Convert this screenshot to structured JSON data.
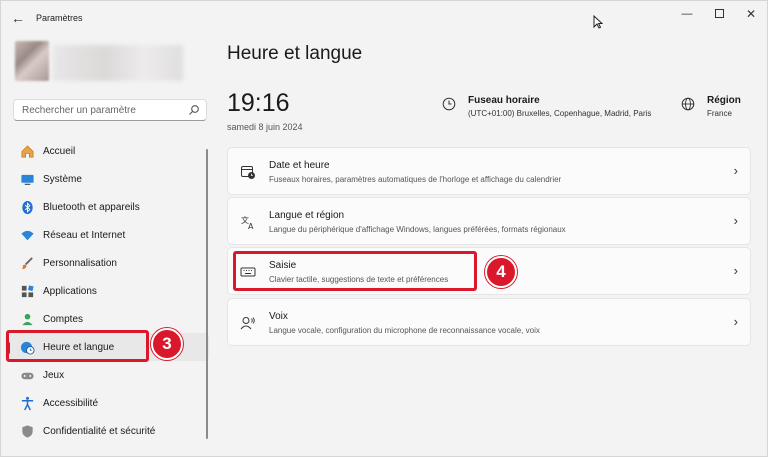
{
  "window": {
    "title": "Paramètres"
  },
  "search": {
    "placeholder": "Rechercher un paramètre"
  },
  "sidebar": {
    "items": [
      {
        "label": "Accueil",
        "icon": "home-icon"
      },
      {
        "label": "Système",
        "icon": "monitor-icon"
      },
      {
        "label": "Bluetooth et appareils",
        "icon": "bluetooth-icon"
      },
      {
        "label": "Réseau et Internet",
        "icon": "wifi-icon"
      },
      {
        "label": "Personnalisation",
        "icon": "brush-icon"
      },
      {
        "label": "Applications",
        "icon": "apps-icon"
      },
      {
        "label": "Comptes",
        "icon": "person-icon"
      },
      {
        "label": "Heure et langue",
        "icon": "globe-clock-icon",
        "active": true
      },
      {
        "label": "Jeux",
        "icon": "gamepad-icon"
      },
      {
        "label": "Accessibilité",
        "icon": "accessibility-icon"
      },
      {
        "label": "Confidentialité et sécurité",
        "icon": "shield-icon"
      }
    ]
  },
  "main": {
    "title": "Heure et langue",
    "clock": "19:16",
    "date": "samedi 8 juin 2024",
    "timezone": {
      "label": "Fuseau horaire",
      "value": "(UTC+01:00) Bruxelles, Copenhague, Madrid, Paris"
    },
    "region": {
      "label": "Région",
      "value": "France"
    },
    "cards": [
      {
        "title": "Date et heure",
        "subtitle": "Fuseaux horaires, paramètres automatiques de l'horloge et affichage du calendrier",
        "icon": "calendar-clock-icon"
      },
      {
        "title": "Langue et région",
        "subtitle": "Langue du périphérique d'affichage Windows, langues préférées, formats régionaux",
        "icon": "language-icon"
      },
      {
        "title": "Saisie",
        "subtitle": "Clavier tactile, suggestions de texte et préférences",
        "icon": "keyboard-icon"
      },
      {
        "title": "Voix",
        "subtitle": "Langue vocale, configuration du microphone de reconnaissance vocale, voix",
        "icon": "voice-icon"
      }
    ]
  },
  "annotations": {
    "step3": "3",
    "step4": "4"
  },
  "colors": {
    "accent": "#0067c0",
    "highlight": "#d9192b"
  }
}
